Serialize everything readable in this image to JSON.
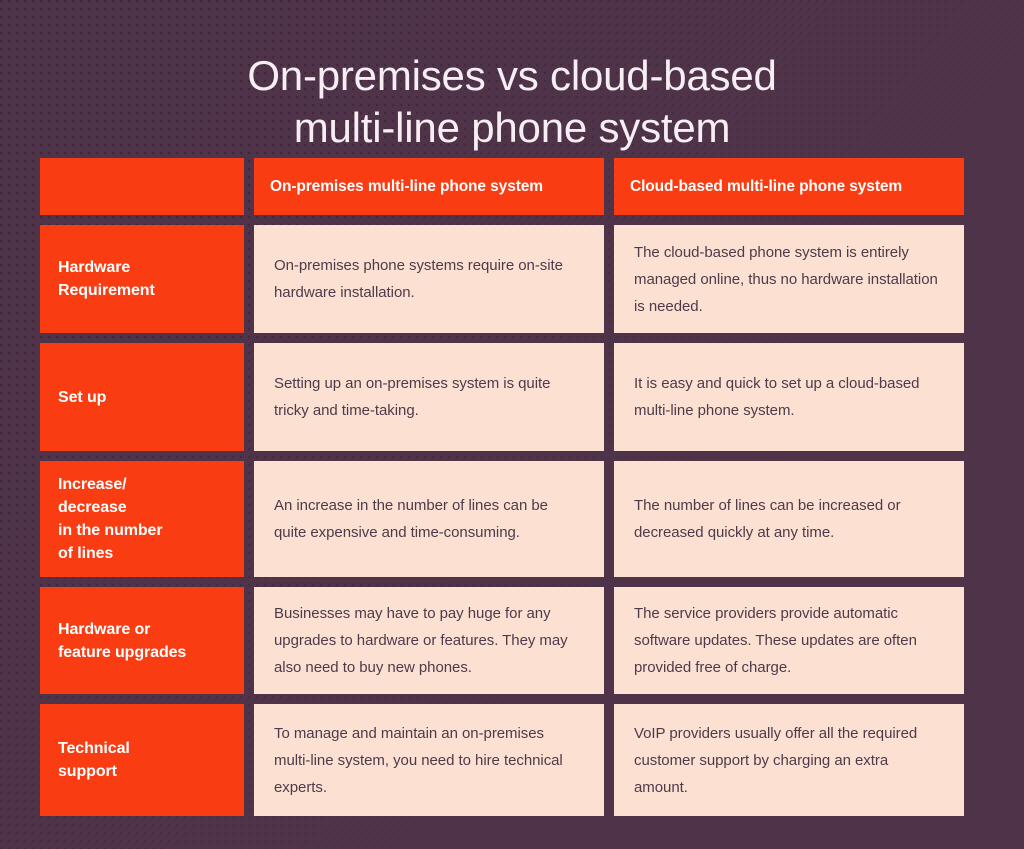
{
  "theme": {
    "background": "#4e3349",
    "accent_orange": "#fa3c13",
    "cell_cream": "#fce1d3",
    "title_color": "#f6eef3",
    "body_text_color": "#4d3b4a"
  },
  "title": "On-premises vs cloud-based\nmulti-line phone system",
  "table": {
    "header": {
      "label_column": "",
      "columns": [
        "On-premises multi-line phone system",
        "Cloud-based multi-line phone system"
      ]
    },
    "rows": [
      {
        "label": "Hardware\nRequirement",
        "on_premises": "On-premises phone systems require on-site hardware installation.",
        "cloud_based": "The cloud-based phone system is entirely managed online, thus no hardware installation is needed."
      },
      {
        "label": "Set up",
        "on_premises": "Setting up an on-premises system is quite tricky and time-taking.",
        "cloud_based": "It is easy and quick to set up a cloud-based multi-line phone system."
      },
      {
        "label": "Increase/\ndecrease\nin the number\nof lines",
        "on_premises": "An increase in the number of lines can be quite expensive and time-consuming.",
        "cloud_based": "The number of lines can be increased or decreased quickly at any time."
      },
      {
        "label": "Hardware or\nfeature upgrades",
        "on_premises": "Businesses may have to pay huge for any upgrades to hardware or features.  They may also need to buy new phones.",
        "cloud_based": "The service providers provide automatic software updates. These updates are often provided free of charge."
      },
      {
        "label": "Technical\nsupport",
        "on_premises": "To manage and maintain an on-premises multi-line system, you need to hire technical experts.",
        "cloud_based": "VoIP providers usually offer all the required customer support by charging an extra amount."
      }
    ]
  }
}
